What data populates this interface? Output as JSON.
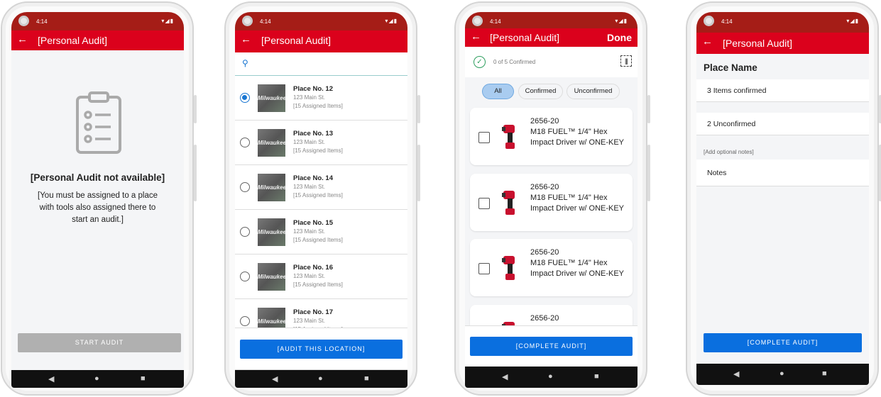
{
  "status": {
    "time": "4:14",
    "icons": "▾◢▮"
  },
  "colors": {
    "status_bar": "#a51d17",
    "app_bar": "#db011c",
    "primary_button": "#0a6fdf",
    "disabled_button": "#b0b0b0"
  },
  "screen1": {
    "title": "[Personal Audit]",
    "icon": "clipboard-icon",
    "heading": "[Personal Audit not available]",
    "message": [
      "[You must be assigned to a place",
      "with tools also assigned there to",
      "start an audit.]"
    ],
    "button": "START AUDIT"
  },
  "screen2": {
    "title": "[Personal Audit]",
    "search_placeholder": "",
    "places": [
      {
        "name": "Place No. 12",
        "address": "123 Main St.",
        "items": "[15 Assigned Items]",
        "selected": true
      },
      {
        "name": "Place No. 13",
        "address": "123 Main St.",
        "items": "[15 Assigned Items]",
        "selected": false
      },
      {
        "name": "Place No. 14",
        "address": "123 Main St.",
        "items": "[15 Assigned Items]",
        "selected": false
      },
      {
        "name": "Place No. 15",
        "address": "123 Main St.",
        "items": "[15 Assigned Items]",
        "selected": false
      },
      {
        "name": "Place No. 16",
        "address": "123 Main St.",
        "items": "[15 Assigned Items]",
        "selected": false
      },
      {
        "name": "Place No. 17",
        "address": "123 Main St.",
        "items": "[15 Assigned Items]",
        "selected": false
      }
    ],
    "thumb_text": "Milwaukee",
    "button": "[AUDIT THIS LOCATION]"
  },
  "screen3": {
    "title": "[Personal Audit]",
    "done": "Done",
    "progress": "0 of 5 Confirmed",
    "filters": [
      "All",
      "Confirmed",
      "Unconfirmed"
    ],
    "active_filter": "All",
    "items": [
      {
        "sku": "2656-20",
        "name": "M18 FUEL™ 1/4\" Hex Impact Driver w/ ONE-KEY"
      },
      {
        "sku": "2656-20",
        "name": "M18 FUEL™ 1/4\" Hex Impact Driver w/ ONE-KEY"
      },
      {
        "sku": "2656-20",
        "name": "M18 FUEL™ 1/4\" Hex Impact Driver w/ ONE-KEY"
      },
      {
        "sku": "2656-20",
        "name": ""
      }
    ],
    "button": "[COMPLETE AUDIT]"
  },
  "screen4": {
    "title": "[Personal Audit]",
    "place_name": "Place Name",
    "confirmed": "3 Items confirmed",
    "unconfirmed": "2 Unconfirmed",
    "notes_label": "[Add optional notes]",
    "notes_placeholder": "Notes",
    "button": "[COMPLETE AUDIT]"
  }
}
